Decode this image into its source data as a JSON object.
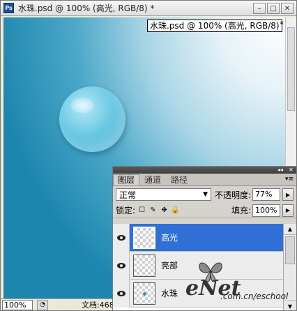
{
  "document": {
    "app_icon": "Ps",
    "title": "水珠.psd @ 100% (高光, RGB/8) *",
    "canvas_label": "水珠.psd @ 100% (高光, RGB/8)",
    "canvas_label_star": "*",
    "window_buttons": {
      "minimize": "–",
      "maximize": "□",
      "close": "✕"
    }
  },
  "status": {
    "zoom": "100%",
    "doc_info": "文档:468"
  },
  "layers_panel": {
    "tabs": [
      {
        "label": "图层",
        "active": true
      },
      {
        "label": "通道",
        "active": false
      },
      {
        "label": "路径",
        "active": false
      }
    ],
    "blend_mode": "正常",
    "opacity_label": "不透明度:",
    "opacity_value": "77%",
    "lock_label": "锁定:",
    "fill_label": "填充:",
    "fill_value": "100%",
    "layers": [
      {
        "name": "高光",
        "selected": true
      },
      {
        "name": "亮部",
        "selected": false
      },
      {
        "name": "水珠",
        "selected": false
      }
    ]
  },
  "watermark": {
    "brand": "eNet",
    "domain": ".com.cn/eschool"
  },
  "icons": {
    "eye": "eye-icon",
    "lock_transparent": "lock-transparent-icon",
    "lock_paint": "brush-icon",
    "lock_move": "move-icon",
    "lock_all": "padlock-icon",
    "dropdown": "chevron-down-icon"
  },
  "colors": {
    "selection": "#2f6fd6",
    "canvas_dark": "#1d86ae",
    "canvas_light": "#ffffff"
  }
}
